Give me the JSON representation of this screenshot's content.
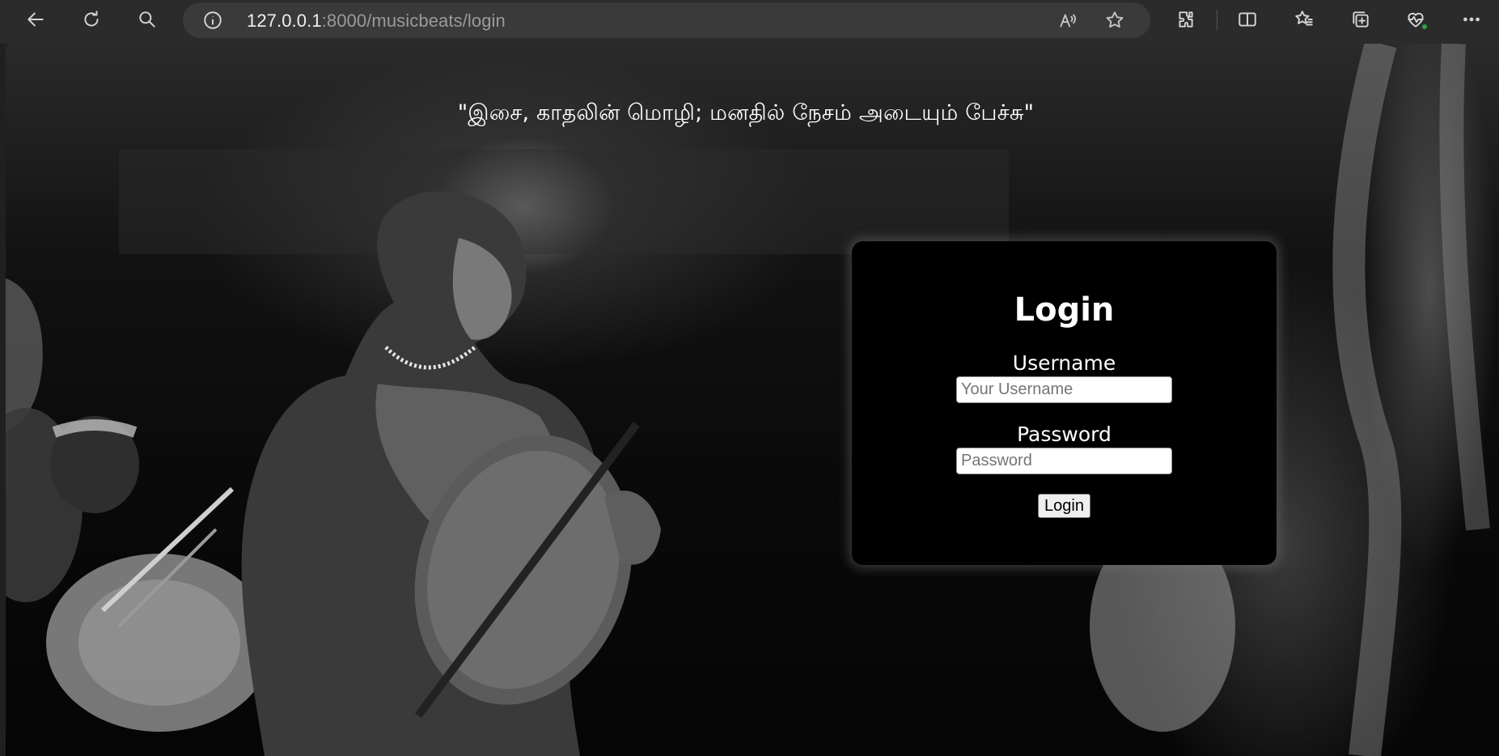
{
  "browser": {
    "url_host": "127.0.0.1",
    "url_rest": ":8000/musicbeats/login",
    "icons": [
      "back-icon",
      "refresh-icon",
      "search-icon",
      "info-icon",
      "read-aloud-icon",
      "favorite-star-icon",
      "extensions-icon",
      "split-screen-icon",
      "favorites-icon",
      "collections-icon",
      "browser-essentials-icon",
      "more-icon"
    ]
  },
  "page": {
    "quote": "\"இசை, காதலின் மொழி; மனதில் நேசம் அடையும் பேச்சு\"",
    "login": {
      "title": "Login",
      "username_label": "Username",
      "username_placeholder": "Your Username",
      "password_label": "Password",
      "password_placeholder": "Password",
      "button_label": "Login"
    }
  }
}
